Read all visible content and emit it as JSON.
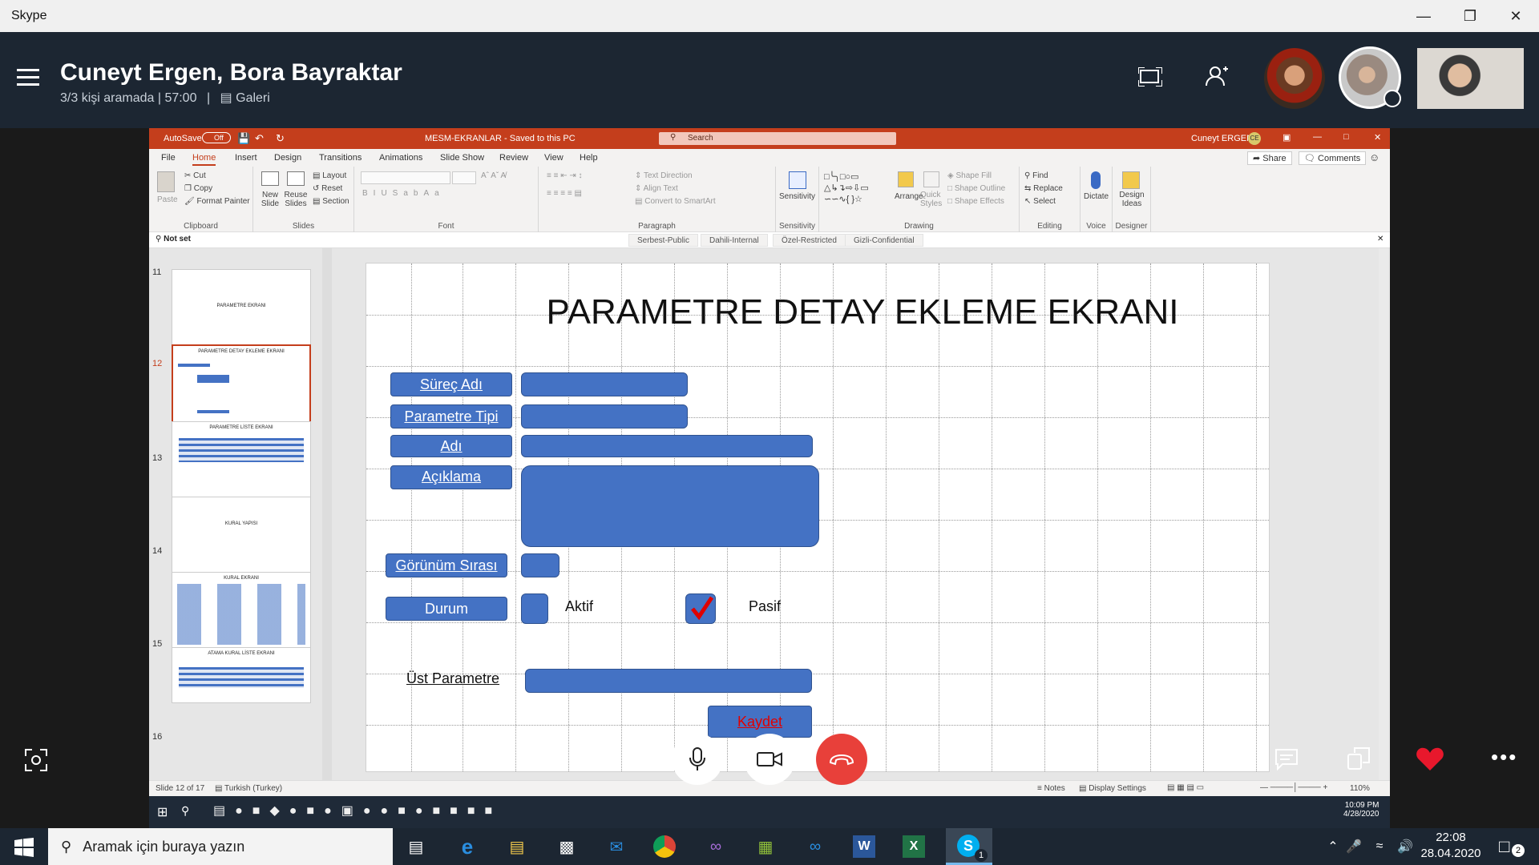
{
  "skype": {
    "app_title": "Skype"
  },
  "call": {
    "participants": "Cuneyt Ergen, Bora Bayraktar",
    "status": "3/3 kişi aramada | 57:00",
    "view_label": "Galeri"
  },
  "ppt": {
    "autosave": "AutoSave",
    "autosave_state": "Off",
    "file_title": "MESM-EKRANLAR  -  Saved to this PC",
    "search_placeholder": "Search",
    "user_name": "Cuneyt ERGEN",
    "user_initials": "CE",
    "menu": [
      "File",
      "Home",
      "Insert",
      "Design",
      "Transitions",
      "Animations",
      "Slide Show",
      "Review",
      "View",
      "Help"
    ],
    "share_label": "Share",
    "comments_label": "Comments",
    "ribbon": {
      "clipboard": {
        "label": "Clipboard",
        "paste": "Paste",
        "cut": "Cut",
        "copy": "Copy",
        "format_painter": "Format Painter"
      },
      "slides": {
        "label": "Slides",
        "new_slide": "New Slide",
        "reuse_slides": "Reuse Slides",
        "layout": "Layout",
        "reset": "Reset",
        "section": "Section"
      },
      "font": {
        "label": "Font"
      },
      "paragraph": {
        "label": "Paragraph",
        "text_direction": "Text Direction",
        "align_text": "Align Text",
        "convert_smartart": "Convert to SmartArt"
      },
      "sensitivity": {
        "label": "Sensitivity",
        "button": "Sensitivity"
      },
      "drawing": {
        "label": "Drawing",
        "arrange": "Arrange",
        "quick_styles": "Quick Styles",
        "shape_fill": "Shape Fill",
        "shape_outline": "Shape Outline",
        "shape_effects": "Shape Effects"
      },
      "editing": {
        "label": "Editing",
        "find": "Find",
        "replace": "Replace",
        "select": "Select"
      },
      "voice": {
        "label": "Voice",
        "dictate": "Dictate"
      },
      "designer": {
        "label": "Designer",
        "design_ideas": "Design Ideas"
      }
    },
    "sensitivity_bar": {
      "not_set": "Not set",
      "tabs": [
        "Serbest-Public",
        "Dahili-Internal",
        "Özel-Restricted",
        "Gizli-Confidential"
      ]
    },
    "thumbnails": [
      {
        "num": "11",
        "title": "PARAMETRE EKRANI"
      },
      {
        "num": "12",
        "title": "PARAMETRE DETAY EKLEME EKRANI"
      },
      {
        "num": "13",
        "title": "PARAMETRE LİSTE EKRANI"
      },
      {
        "num": "14",
        "title": "KURAL YAPISI"
      },
      {
        "num": "15",
        "title": "KURAL EKRANI"
      },
      {
        "num": "16",
        "title": "ATAMA KURAL LİSTE EKRANI"
      }
    ],
    "slide": {
      "title": "PARAMETRE DETAY EKLEME EKRANI",
      "surec_adi": "Süreç Adı",
      "parametre_tipi": "Parametre Tipi",
      "adi": "Adı",
      "aciklama": "Açıklama",
      "gorunum_sirasi": "Görünüm Sırası",
      "durum": "Durum",
      "aktif": "Aktif",
      "pasif": "Pasif",
      "ust_parametre": "Üst Parametre",
      "kaydet": "Kaydet"
    },
    "status": {
      "slide_info": "Slide 12 of 17",
      "language": "Turkish (Turkey)",
      "notes": "Notes",
      "display_settings": "Display Settings",
      "zoom": "110%"
    },
    "inner_clock": {
      "time": "10:09 PM",
      "date": "4/28/2020"
    }
  },
  "taskbar": {
    "search_placeholder": "Aramak için buraya yazın",
    "time": "22:08",
    "date": "28.04.2020",
    "notif_count": "2",
    "skype_badge": "1"
  },
  "colors": {
    "accent_blue": "#4472c4",
    "ppt_red": "#c43e1c",
    "hangup": "#e8403a"
  }
}
